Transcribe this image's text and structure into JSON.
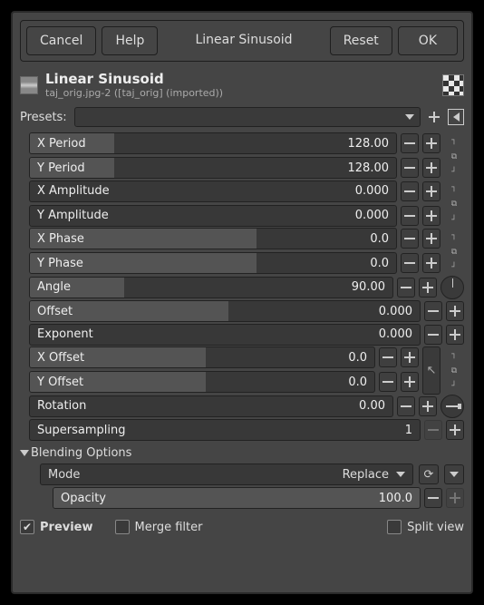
{
  "buttons": {
    "cancel": "Cancel",
    "help": "Help",
    "title": "Linear Sinusoid",
    "reset": "Reset",
    "ok": "OK"
  },
  "header": {
    "title": "Linear Sinusoid",
    "sub": "taj_orig.jpg-2 ([taj_orig] (imported))"
  },
  "presets": {
    "label": "Presets:"
  },
  "params": {
    "x_period": {
      "label": "X Period",
      "value": "128.00",
      "fill": 23
    },
    "y_period": {
      "label": "Y Period",
      "value": "128.00",
      "fill": 23
    },
    "x_amplitude": {
      "label": "X Amplitude",
      "value": "0.000",
      "fill": 0
    },
    "y_amplitude": {
      "label": "Y Amplitude",
      "value": "0.000",
      "fill": 0
    },
    "x_phase": {
      "label": "X Phase",
      "value": "0.0",
      "fill": 62
    },
    "y_phase": {
      "label": "Y Phase",
      "value": "0.0",
      "fill": 62
    },
    "angle": {
      "label": "Angle",
      "value": "90.00",
      "fill": 26
    },
    "offset": {
      "label": "Offset",
      "value": "0.000",
      "fill": 51
    },
    "exponent": {
      "label": "Exponent",
      "value": "0.000",
      "fill": 0
    },
    "x_offset": {
      "label": "X Offset",
      "value": "0.0",
      "fill": 51
    },
    "y_offset": {
      "label": "Y Offset",
      "value": "0.0",
      "fill": 51
    },
    "rotation": {
      "label": "Rotation",
      "value": "0.00",
      "fill": 0
    },
    "supersampling": {
      "label": "Supersampling",
      "value": "1",
      "fill": 0
    }
  },
  "blending": {
    "title": "Blending Options",
    "mode_label": "Mode",
    "mode_value": "Replace",
    "opacity_label": "Opacity",
    "opacity_value": "100.0"
  },
  "footer": {
    "preview": "Preview",
    "merge": "Merge filter",
    "split": "Split view"
  }
}
